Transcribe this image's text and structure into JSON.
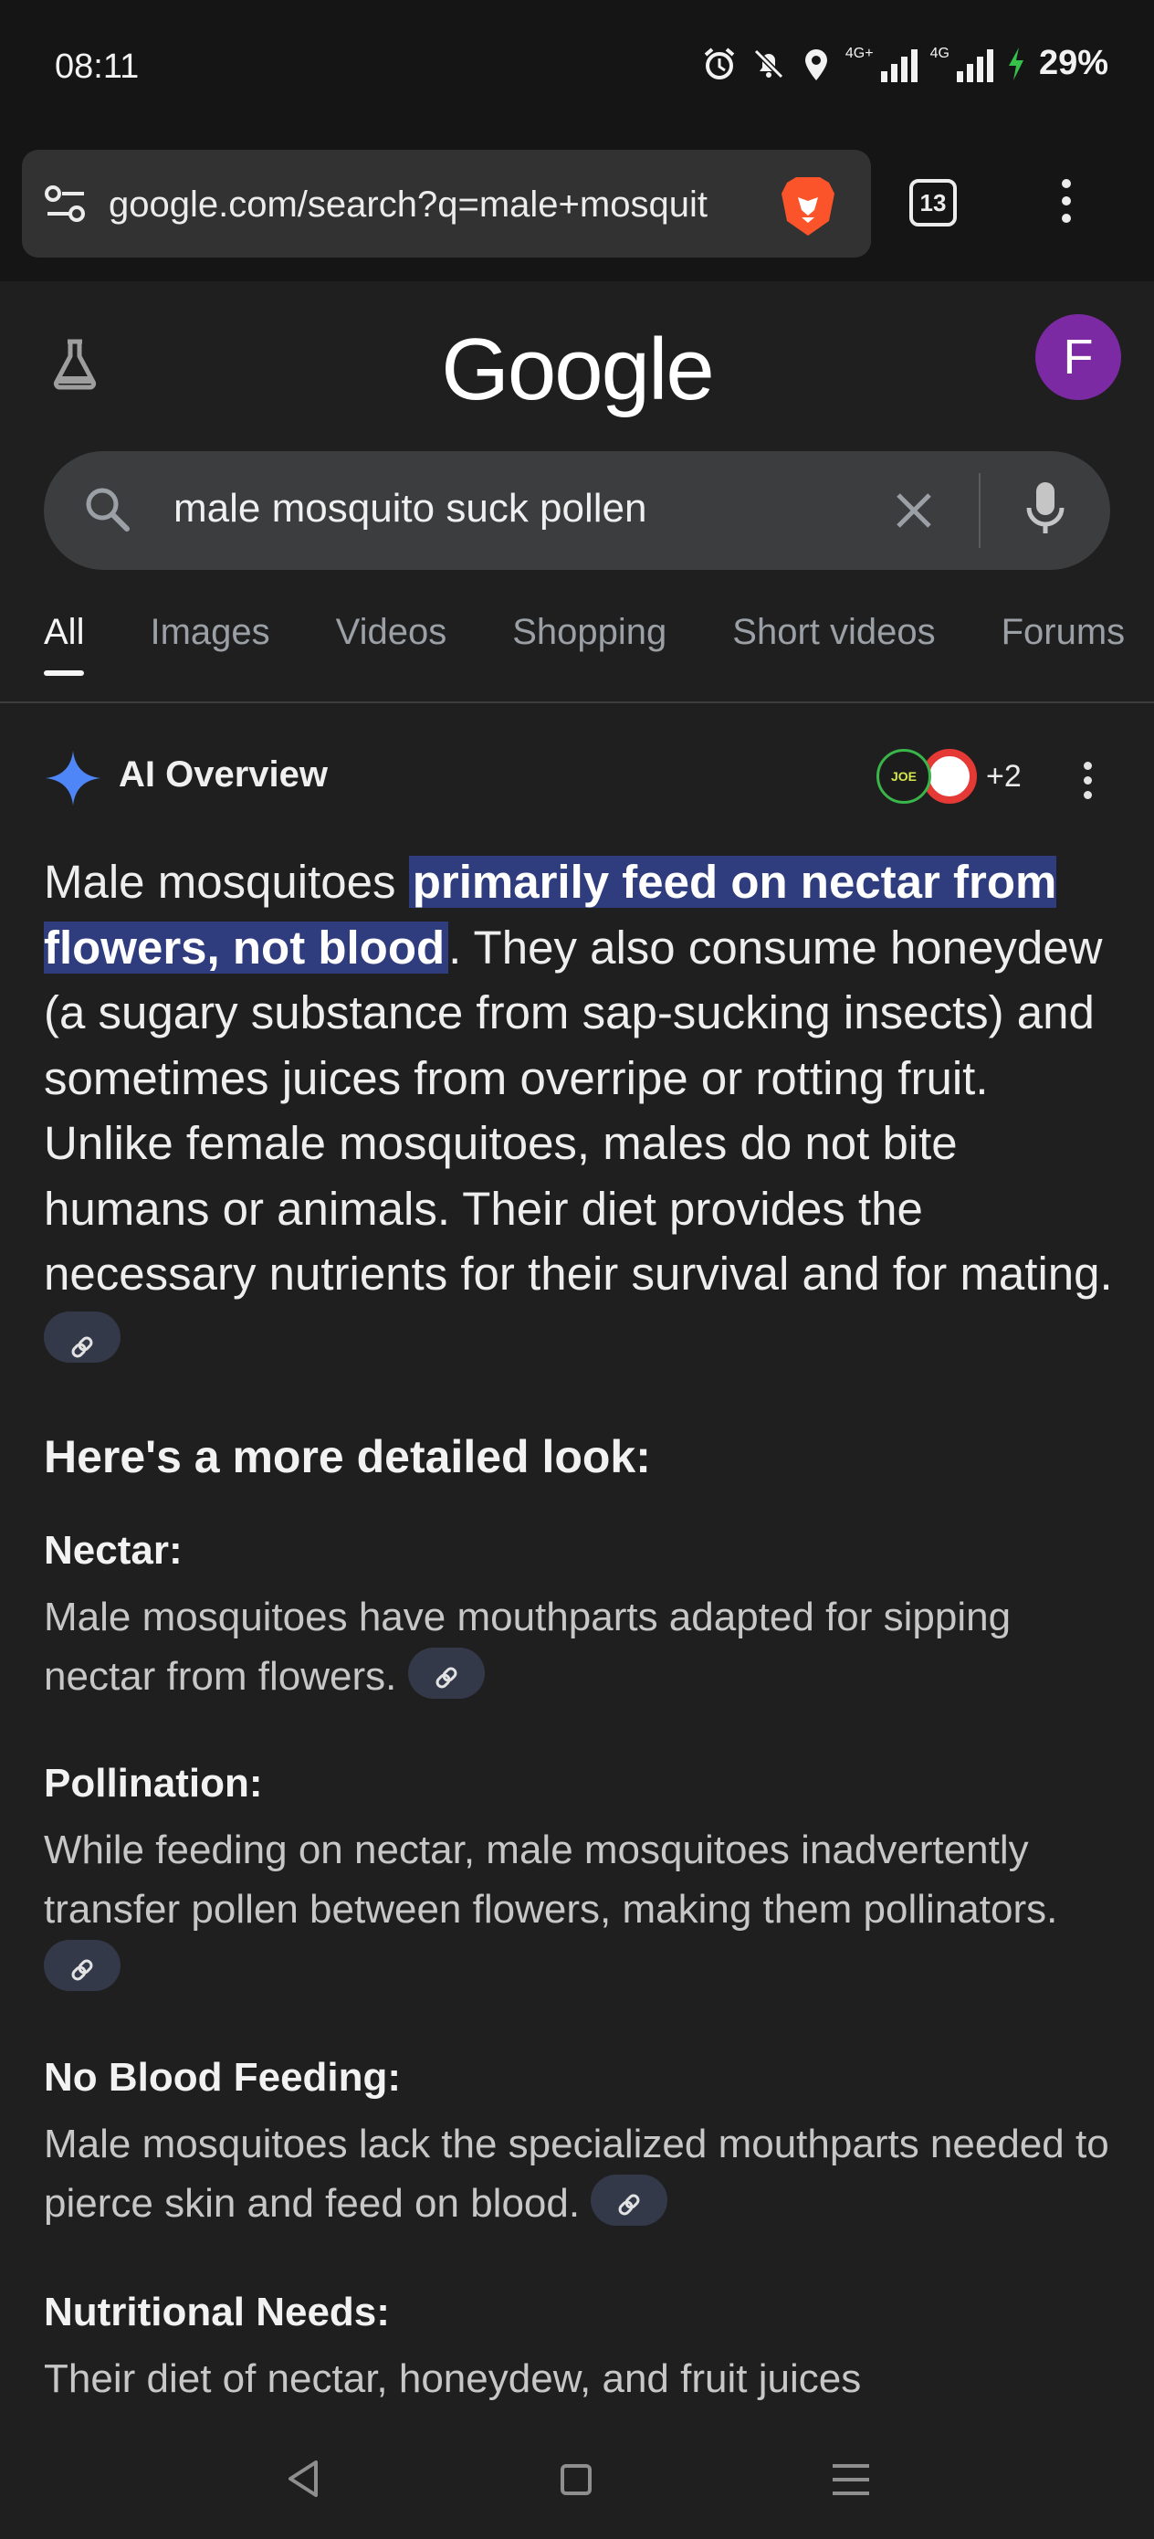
{
  "status_bar": {
    "time": "08:11",
    "battery": "29%",
    "signal1_tag": "4G+",
    "signal2_tag": "4G",
    "icons": [
      "alarm-icon",
      "silent-bell-icon",
      "location-icon",
      "signal-icon",
      "signal-icon",
      "charging-icon"
    ]
  },
  "browser": {
    "url": "google.com/search?q=male+mosquit",
    "tab_count": "13",
    "icons": [
      "tune-icon",
      "brave-lion-icon",
      "more-vert-icon"
    ]
  },
  "google": {
    "logo": "Google",
    "avatar_letter": "F",
    "labs_icon": "flask-icon"
  },
  "search": {
    "query": "male mosquito suck pollen"
  },
  "tabs": [
    "All",
    "Images",
    "Videos",
    "Shopping",
    "Short videos",
    "Forums"
  ],
  "active_tab": "All",
  "ai_overview": {
    "title": "AI Overview",
    "source1_label": "JOE",
    "more_sources": "+2",
    "lead_pre": "Male mosquitoes ",
    "lead_highlight": "primarily feed on nectar from flowers, not blood",
    "lead_post": ". They also consume honeydew (a sugary substance from sap-sucking insects) and sometimes juices from overripe or rotting fruit. Unlike female mosquitoes, males do not bite humans or animals. Their diet provides the necessary nutrients for their survival and for mating.",
    "subheading": "Here's a more detailed look:",
    "items": [
      {
        "title": "Nectar:",
        "text": "Male mosquitoes have mouthparts adapted for sipping nectar from flowers."
      },
      {
        "title": "Pollination:",
        "text": "While feeding on nectar, male mosquitoes inadvertently transfer pollen between flowers, making them pollinators."
      },
      {
        "title": "No Blood Feeding:",
        "text": "Male mosquitoes lack the specialized mouthparts needed to pierce skin and feed on blood."
      },
      {
        "title": "Nutritional Needs:",
        "text": "Their diet of nectar, honeydew, and fruit juices"
      }
    ]
  },
  "colors": {
    "highlight": "#2f3c7e",
    "avatar": "#7b2aa3",
    "spark_blue": "#4f86f7"
  }
}
